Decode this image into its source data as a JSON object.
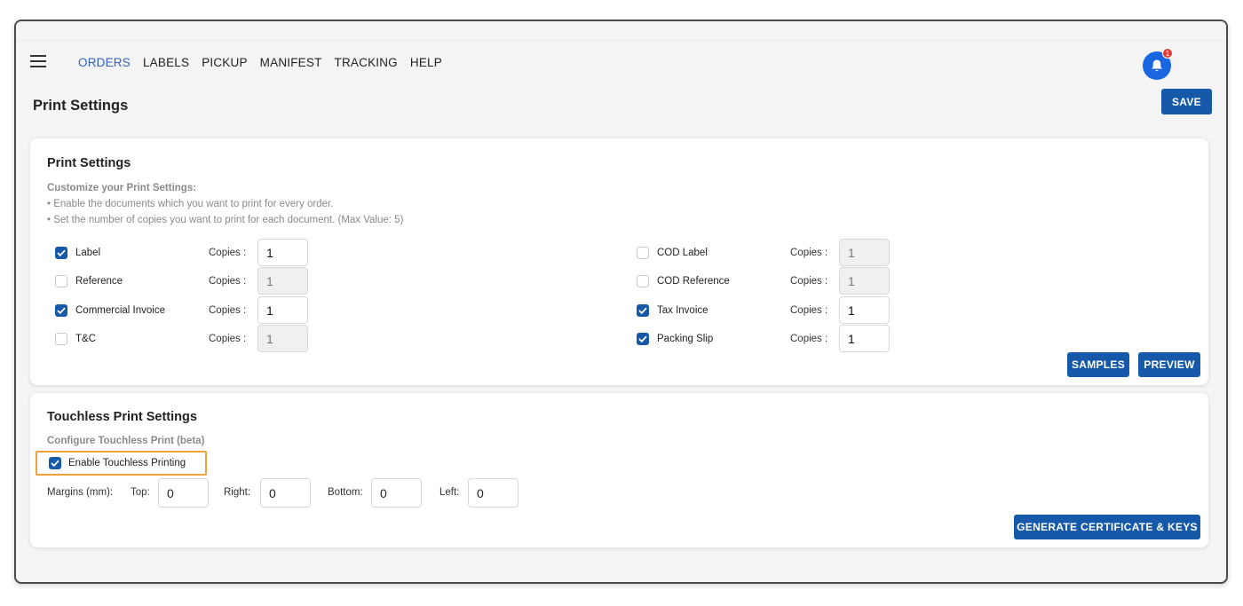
{
  "nav": {
    "items": [
      {
        "label": "ORDERS",
        "active": true
      },
      {
        "label": "LABELS",
        "active": false
      },
      {
        "label": "PICKUP",
        "active": false
      },
      {
        "label": "MANIFEST",
        "active": false
      },
      {
        "label": "TRACKING",
        "active": false
      },
      {
        "label": "HELP",
        "active": false
      }
    ],
    "notification_count": "1"
  },
  "header": {
    "title": "Print Settings",
    "save_label": "SAVE"
  },
  "print_settings": {
    "title": "Print Settings",
    "subhead": "Customize your Print Settings:",
    "bullets": [
      "• Enable the documents which you want to print for every order.",
      "• Set the number of copies you want to print for each document. (Max Value: 5)"
    ],
    "copies_label": "Copies :",
    "documents_left": [
      {
        "label": "Label",
        "checked": true,
        "copies": "1"
      },
      {
        "label": "Reference",
        "checked": false,
        "copies": "1"
      },
      {
        "label": "Commercial Invoice",
        "checked": true,
        "copies": "1"
      },
      {
        "label": "T&C",
        "checked": false,
        "copies": "1"
      }
    ],
    "documents_right": [
      {
        "label": "COD Label",
        "checked": false,
        "copies": "1"
      },
      {
        "label": "COD Reference",
        "checked": false,
        "copies": "1"
      },
      {
        "label": "Tax Invoice",
        "checked": true,
        "copies": "1"
      },
      {
        "label": "Packing Slip",
        "checked": true,
        "copies": "1"
      }
    ],
    "samples_label": "SAMPLES",
    "preview_label": "PREVIEW"
  },
  "touchless": {
    "title": "Touchless Print Settings",
    "subhead": "Configure Touchless Print (beta)",
    "enable_label": "Enable Touchless Printing",
    "enable_checked": true,
    "margins_label": "Margins (mm):",
    "top_label": "Top:",
    "top_value": "0",
    "right_label": "Right:",
    "right_value": "0",
    "bottom_label": "Bottom:",
    "bottom_value": "0",
    "left_label": "Left:",
    "left_value": "0",
    "generate_label": "GENERATE CERTIFICATE & KEYS"
  },
  "colors": {
    "accent": "#1559a8",
    "nav_active": "#2f5fbf",
    "highlight_border": "#f0a13c",
    "bell": "#1a66e0",
    "badge": "#e53935"
  }
}
